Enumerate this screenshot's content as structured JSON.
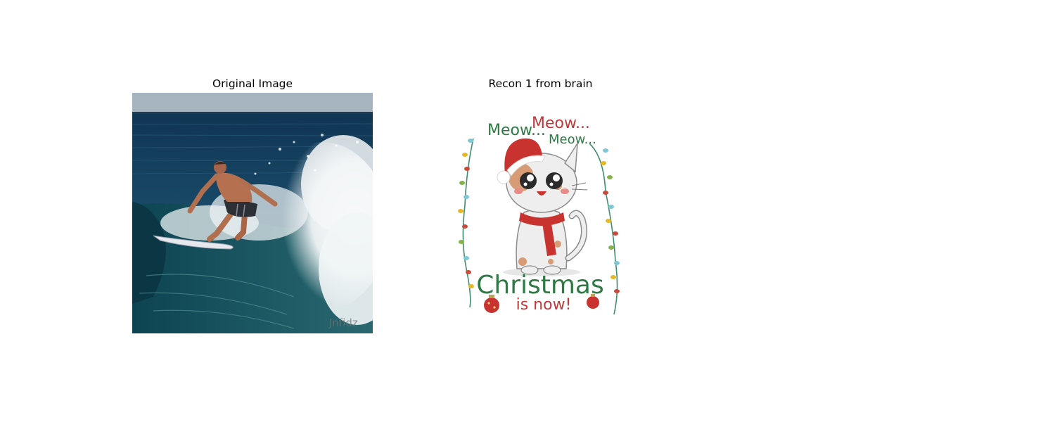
{
  "figure": {
    "panels": [
      {
        "title": "Original Image",
        "watermark": "Jnfidz"
      },
      {
        "title": "Recon 1 from brain"
      }
    ]
  },
  "poster": {
    "meow_left": "Meow...",
    "meow_top": "Meow...",
    "meow_right": "Meow...",
    "christmas": "Christmas",
    "is_now": "is now!"
  },
  "colors": {
    "sky": "#a9b7c2",
    "sea_deep": "#123b57",
    "foam": "#f2f4f4",
    "greeting_green": "#2f7a44",
    "greeting_red": "#c0393a",
    "hat_red": "#c8332f"
  }
}
